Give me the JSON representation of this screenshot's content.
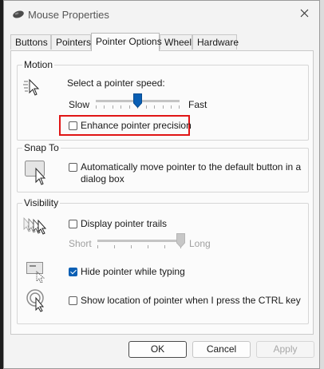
{
  "window": {
    "title": "Mouse Properties",
    "icon": "mouse-icon",
    "close_icon": "close-icon"
  },
  "tabs": [
    {
      "label": "Buttons",
      "active": false
    },
    {
      "label": "Pointers",
      "active": false
    },
    {
      "label": "Pointer Options",
      "active": true
    },
    {
      "label": "Wheel",
      "active": false
    },
    {
      "label": "Hardware",
      "active": false
    }
  ],
  "motion": {
    "group_label": "Motion",
    "speed_label": "Select a pointer speed:",
    "slow_label": "Slow",
    "fast_label": "Fast",
    "speed_level": 0.5,
    "enhance_precision": {
      "label": "Enhance pointer precision",
      "checked": false,
      "highlighted": true
    }
  },
  "snap_to": {
    "group_label": "Snap To",
    "auto_move": {
      "label_line1": "Automatically move pointer to the default button in a",
      "label_line2": "dialog box",
      "checked": false
    }
  },
  "visibility": {
    "group_label": "Visibility",
    "trails": {
      "label": "Display pointer trails",
      "checked": false
    },
    "short_label": "Short",
    "long_label": "Long",
    "trail_level": 1.0,
    "hide_typing": {
      "label": "Hide pointer while typing",
      "checked": true
    },
    "show_location": {
      "label": "Show location of pointer when I press the CTRL key",
      "checked": false
    }
  },
  "buttons": {
    "ok": "OK",
    "cancel": "Cancel",
    "apply": "Apply"
  },
  "colors": {
    "accent": "#0a5fb4",
    "highlight": "#e01515"
  }
}
